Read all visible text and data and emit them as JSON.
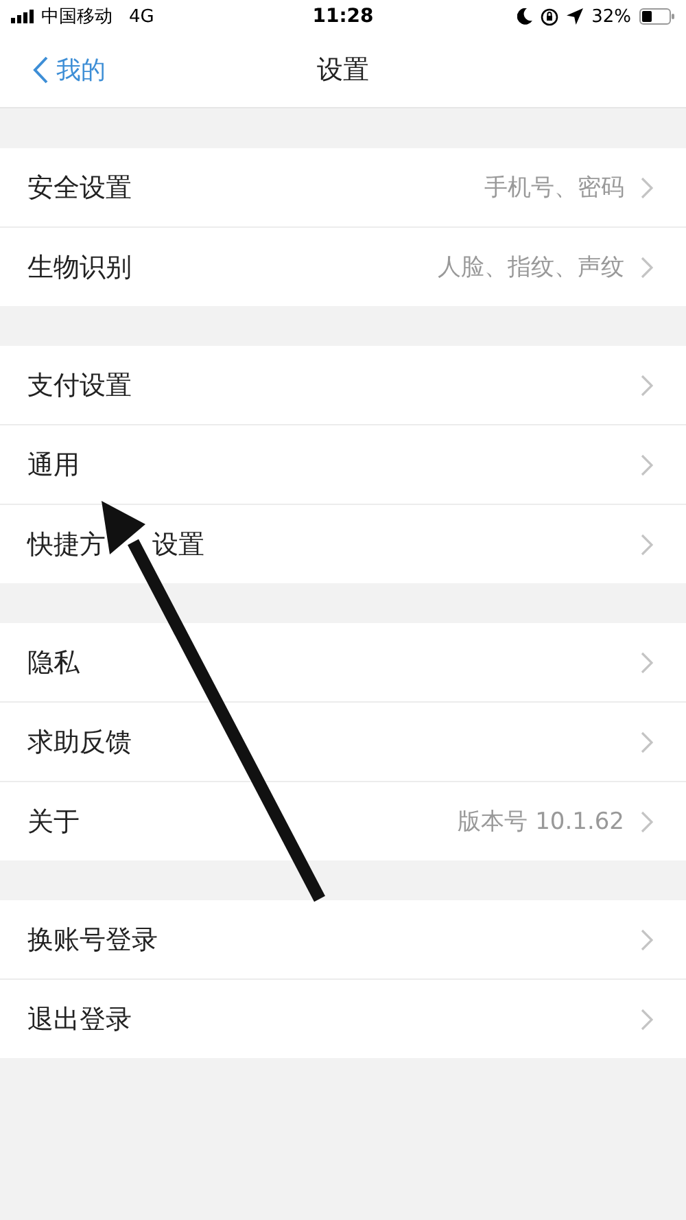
{
  "status_bar": {
    "carrier": "中国移动",
    "network": "4G",
    "time": "11:28",
    "battery": "32%"
  },
  "nav": {
    "back": "我的",
    "title": "设置"
  },
  "sections": [
    {
      "rows": [
        {
          "label": [
            "安全设置"
          ],
          "value": "手机号、密码"
        },
        {
          "label": [
            "生物识别"
          ],
          "value": "人脸、指纹、声纹"
        }
      ]
    },
    {
      "rows": [
        {
          "label": [
            "支付设置"
          ]
        },
        {
          "label": [
            "通用"
          ]
        },
        {
          "label": [
            "快捷方",
            "设置"
          ]
        }
      ]
    },
    {
      "rows": [
        {
          "label": [
            "隐私"
          ]
        },
        {
          "label": [
            "求助反馈"
          ]
        },
        {
          "label": [
            "关于"
          ],
          "value": "版本号 10.1.62"
        }
      ]
    },
    {
      "rows": [
        {
          "label": [
            "换账号登录"
          ]
        },
        {
          "label": [
            "退出登录"
          ]
        }
      ]
    }
  ]
}
